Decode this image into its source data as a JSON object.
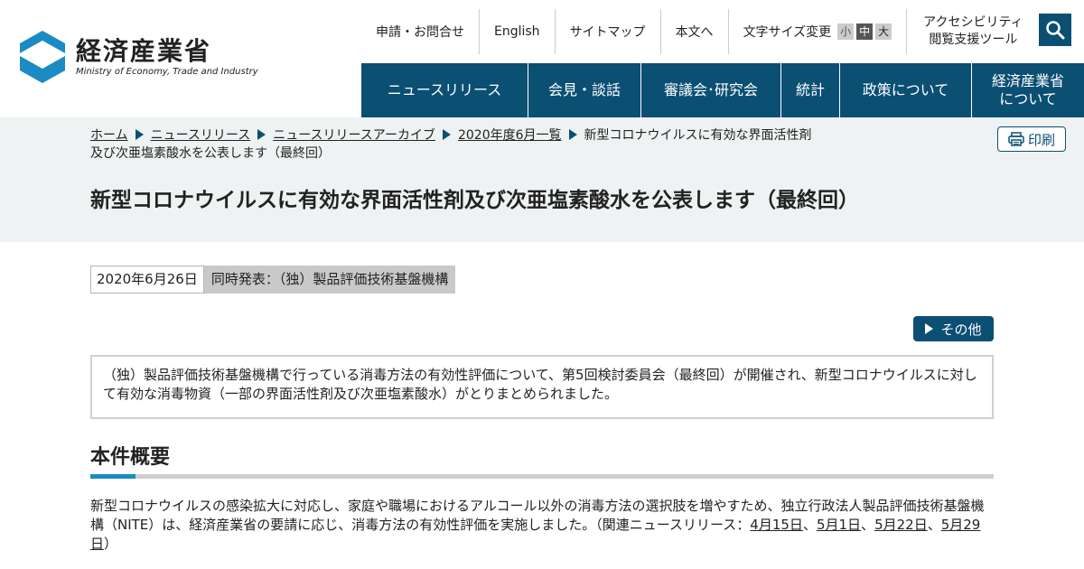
{
  "logo": {
    "name_jp": "経済産業省",
    "name_en": "Ministry of Economy, Trade and Industry"
  },
  "utility_nav": {
    "inquiry": "申請・お問合せ",
    "english": "English",
    "sitemap": "サイトマップ",
    "skip_to_content": "本文へ",
    "font_size_label": "文字サイズ変更",
    "font_small": "小",
    "font_medium": "中",
    "font_large": "大",
    "accessibility_line1": "アクセシビリティ",
    "accessibility_line2": "閲覧支援ツール"
  },
  "main_nav": [
    {
      "label": "ニュースリリース"
    },
    {
      "label": "会見・談話"
    },
    {
      "label": "審議会･研究会"
    },
    {
      "label": "統計"
    },
    {
      "label": "政策について"
    },
    {
      "label_line1": "経済産業省",
      "label_line2": "について"
    }
  ],
  "breadcrumb": [
    "ホーム",
    "ニュースリリース",
    "ニュースリリースアーカイブ",
    "2020年度6月一覧",
    "新型コロナウイルスに有効な界面活性剤及び次亜塩素酸水を公表します（最終回）"
  ],
  "print_label": "印刷",
  "page_title": "新型コロナウイルスに有効な界面活性剤及び次亜塩素酸水を公表します（最終回）",
  "meta": {
    "date": "2020年6月26日",
    "joint_release": "同時発表：（独）製品評価技術基盤機構"
  },
  "other_label": "その他",
  "summary": "（独）製品評価技術基盤機構で行っている消毒方法の有効性評価について、第5回検討委員会（最終回）が開催され、新型コロナウイルスに対して有効な消毒物資（一部の界面活性剤及び次亜塩素酸水）がとりまとめられました。",
  "section": {
    "title": "本件概要",
    "text_before": "新型コロナウイルスの感染拡大に対応し、家庭や職場におけるアルコール以外の消毒方法の選択肢を増やすため、独立行政法人製品評価技術基盤機構（NITE）は、経済産業省の要請に応じ、消毒方法の有効性評価を実施しました。（関連ニュースリリース：",
    "links": [
      "4月15日",
      "5月1日",
      "5月22日",
      "5月29日"
    ],
    "separator": "、",
    "text_after": "）"
  },
  "colors": {
    "brand_navy": "#0b4f73",
    "accent_blue": "#1a8bc3",
    "band_bg": "#eef2f2"
  },
  "icons": {
    "search": "search-icon",
    "print": "printer-icon",
    "logo": "meti-logo-icon"
  }
}
